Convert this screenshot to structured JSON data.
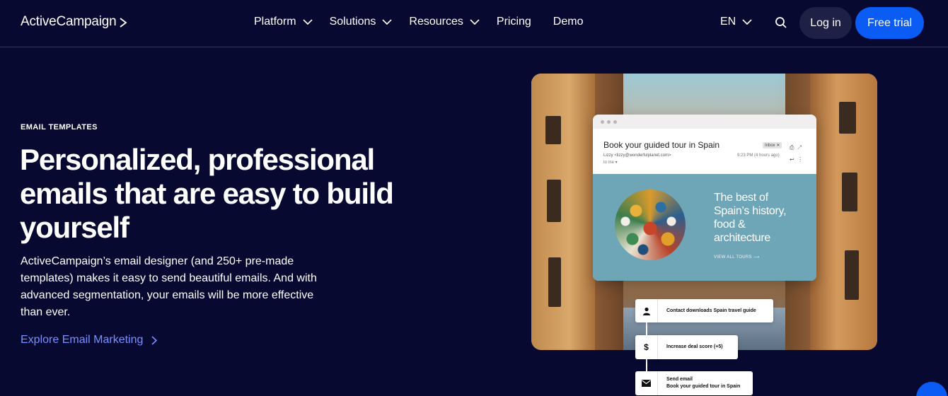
{
  "nav": {
    "logo": "ActiveCampaign",
    "menu": [
      {
        "label": "Platform",
        "has_dropdown": true
      },
      {
        "label": "Solutions",
        "has_dropdown": true
      },
      {
        "label": "Resources",
        "has_dropdown": true
      },
      {
        "label": "Pricing",
        "has_dropdown": false
      },
      {
        "label": "Demo",
        "has_dropdown": false
      }
    ],
    "language": "EN",
    "search_icon": "search-icon",
    "login_label": "Log in",
    "trial_label": "Free trial"
  },
  "hero": {
    "eyebrow": "EMAIL TEMPLATES",
    "headline": "Personalized, professional emails that are easy to build yourself",
    "description": "ActiveCampaign’s email designer (and 250+ pre-made templates) makes it easy to send beautiful emails. And with advanced segmentation, your emails will be more effective than ever.",
    "cta": "Explore Email Marketing"
  },
  "email_preview": {
    "subject": "Book your guided tour in Spain",
    "inbox_tag": "Inbox ✕",
    "from": "Lizzy <lizzy@wonderfulplanet.com>",
    "time": "9:23 PM (4 hours ago)",
    "to": "to me ▾",
    "banner_title": "The best of Spain’s history, food & architecture",
    "banner_link": "VIEW ALL TOURS ⟶"
  },
  "automation": [
    {
      "icon": "person-icon",
      "text": "Contact downloads Spain travel guide"
    },
    {
      "icon": "dollar-icon",
      "text": "Increase deal score (+5)"
    },
    {
      "icon": "mail-icon",
      "title": "Send email",
      "text": "Book your guided tour in Spain"
    }
  ],
  "colors": {
    "background": "#080930",
    "accent": "#0a5cf5",
    "link": "#7b90ff"
  }
}
